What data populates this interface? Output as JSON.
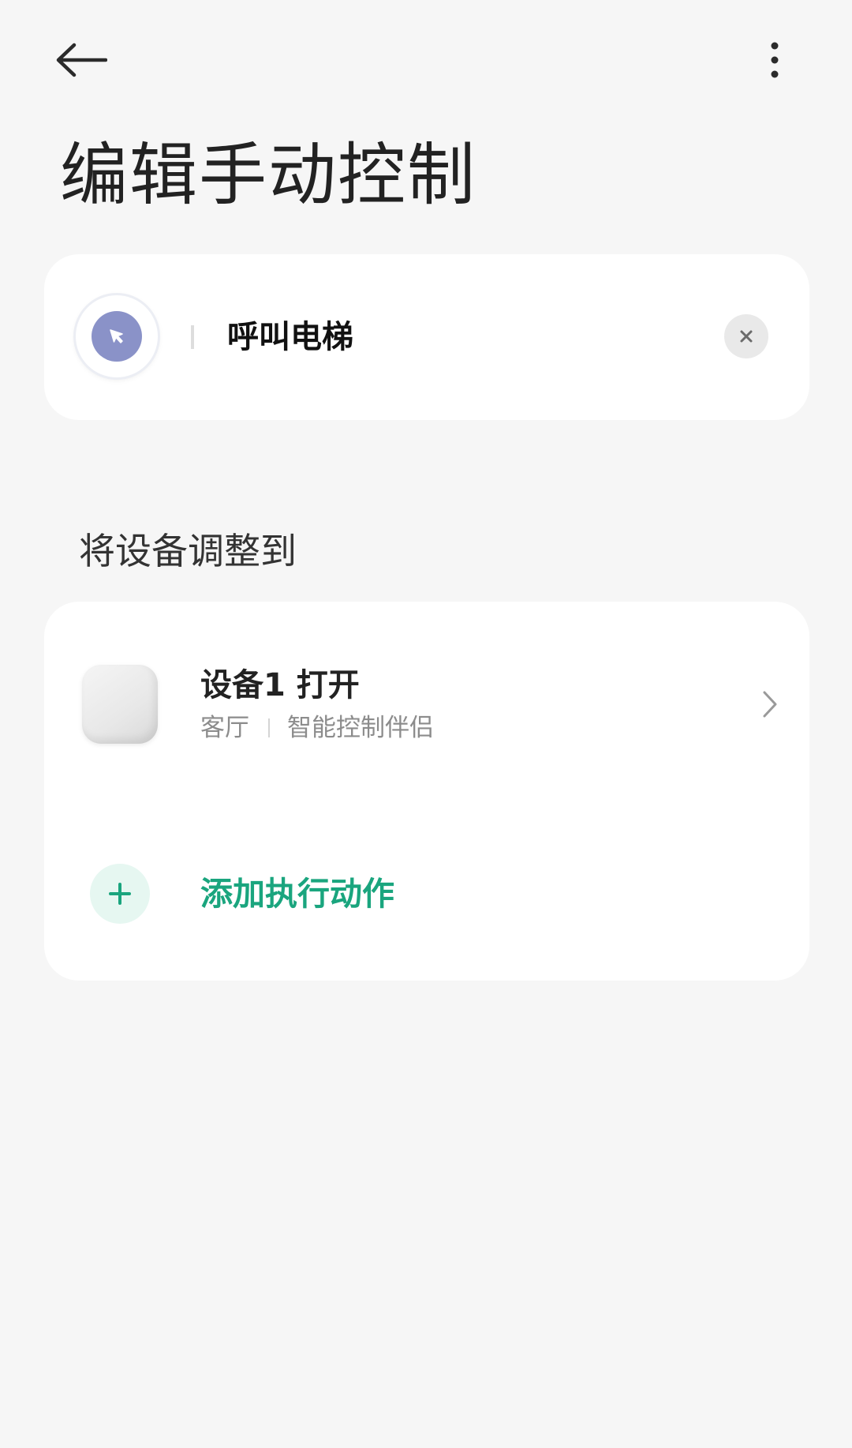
{
  "header": {
    "back_icon": "arrow-left-icon",
    "more_icon": "more-vertical-icon",
    "title": "编辑手动控制"
  },
  "scene": {
    "icon": "cursor-arrow-icon",
    "name": "呼叫电梯",
    "clear_icon": "close-icon"
  },
  "section": {
    "label": "将设备调整到"
  },
  "actions": [
    {
      "title": "设备1 打开",
      "room": "客厅",
      "device_type": "智能控制伴侣",
      "chevron_icon": "chevron-right-icon"
    }
  ],
  "add_action": {
    "label": "添加执行动作",
    "icon": "plus-icon"
  },
  "colors": {
    "background": "#f6f6f6",
    "card": "#ffffff",
    "accent_green": "#1aa57e",
    "scene_icon": "#8a92c8"
  }
}
